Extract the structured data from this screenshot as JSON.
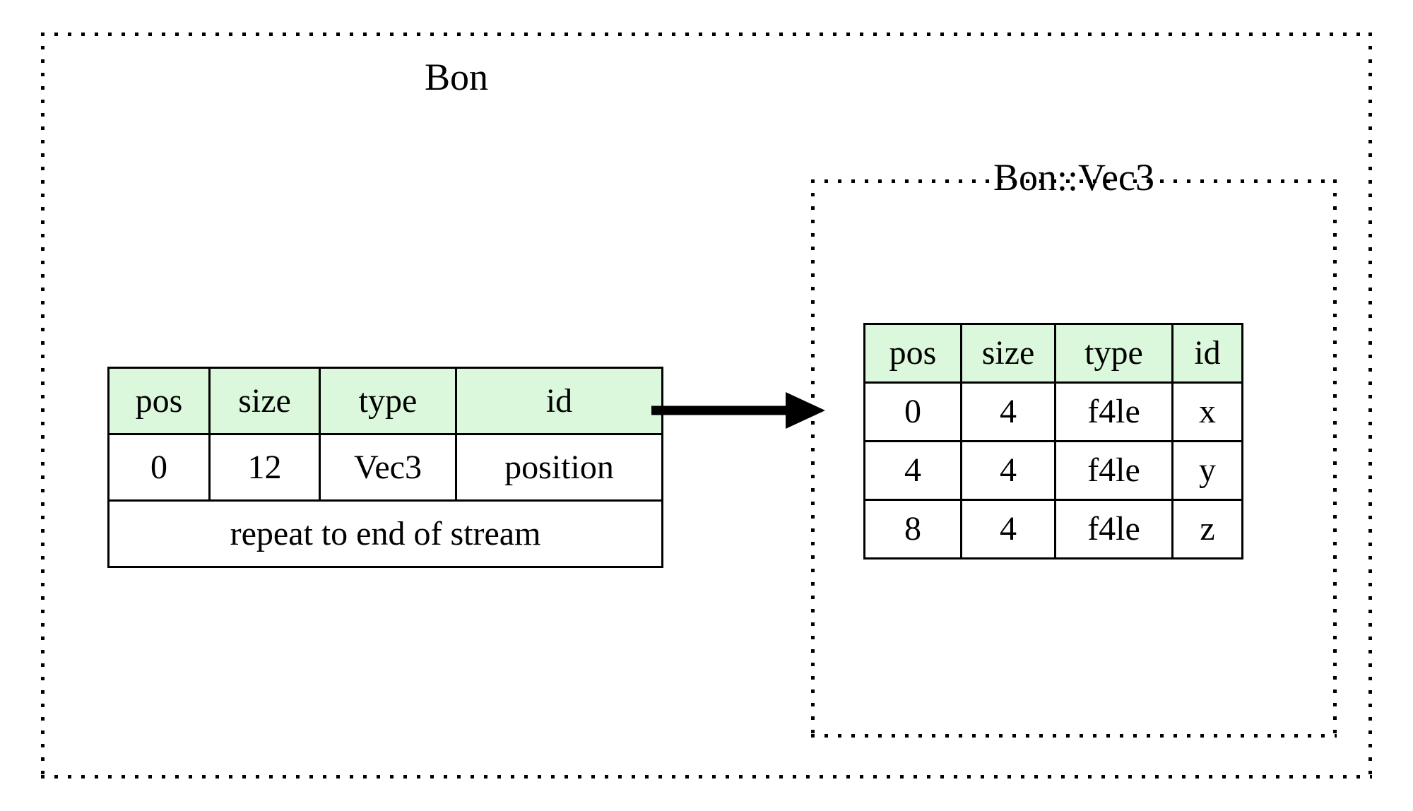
{
  "diagram": {
    "type": "record-struct-layout",
    "background_color": "#ffffff",
    "header_fill_color": "#dcf8dc",
    "line_color": "#000000",
    "clusters": [
      {
        "name": "bon",
        "title": "Bon",
        "border_style": "dotted"
      },
      {
        "name": "bon-vec3",
        "title": "Bon::Vec3",
        "border_style": "dotted"
      }
    ]
  },
  "bon_table": {
    "columns": [
      "pos",
      "size",
      "type",
      "id"
    ],
    "rows": [
      {
        "pos": "0",
        "size": "12",
        "type": "Vec3",
        "id": "position"
      }
    ],
    "footer": "repeat to end of stream"
  },
  "vec3_table": {
    "columns": [
      "pos",
      "size",
      "type",
      "id"
    ],
    "rows": [
      {
        "pos": "0",
        "size": "4",
        "type": "f4le",
        "id": "x"
      },
      {
        "pos": "4",
        "size": "4",
        "type": "f4le",
        "id": "y"
      },
      {
        "pos": "8",
        "size": "4",
        "type": "f4le",
        "id": "z"
      }
    ]
  },
  "edges": [
    {
      "name": "position-to-vec3",
      "from": "bon_table.row0.position",
      "to": "vec3_table",
      "style": "solid",
      "arrowhead": "filled-triangle"
    }
  ]
}
